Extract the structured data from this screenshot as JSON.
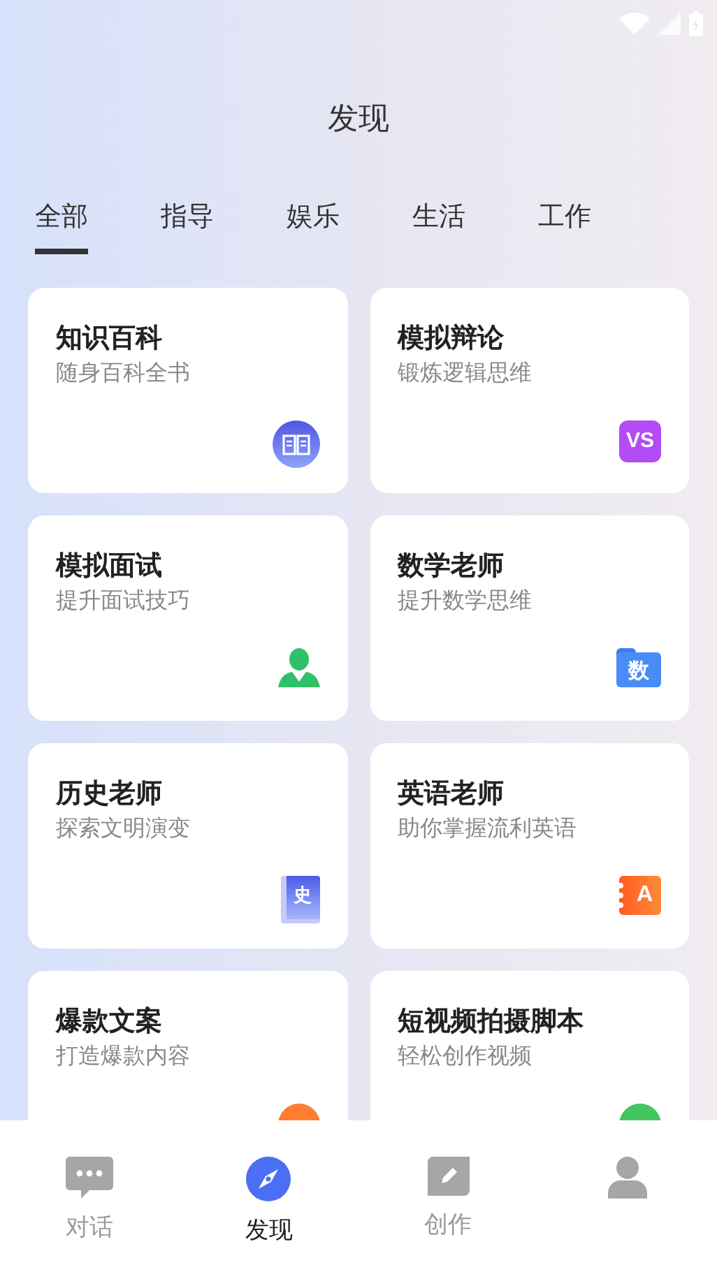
{
  "header": {
    "title": "发现"
  },
  "tabs": [
    {
      "label": "全部",
      "selected": true
    },
    {
      "label": "指导",
      "selected": false
    },
    {
      "label": "娱乐",
      "selected": false
    },
    {
      "label": "生活",
      "selected": false
    },
    {
      "label": "工作",
      "selected": false
    }
  ],
  "cards": [
    {
      "title": "知识百科",
      "subtitle": "随身百科全书",
      "kind": "book"
    },
    {
      "title": "模拟辩论",
      "subtitle": "锻炼逻辑思维",
      "kind": "vs",
      "badge": "VS"
    },
    {
      "title": "模拟面试",
      "subtitle": "提升面试技巧",
      "kind": "person"
    },
    {
      "title": "数学老师",
      "subtitle": "提升数学思维",
      "kind": "folder",
      "badge": "数"
    },
    {
      "title": "历史老师",
      "subtitle": "探索文明演变",
      "kind": "history",
      "badge": "史"
    },
    {
      "title": "英语老师",
      "subtitle": "助你掌握流利英语",
      "kind": "notebook",
      "badge": "A"
    },
    {
      "title": "爆款文案",
      "subtitle": "打造爆款内容",
      "kind": "orange"
    },
    {
      "title": "短视频拍摄脚本",
      "subtitle": "轻松创作视频",
      "kind": "green"
    }
  ],
  "bottom_nav": [
    {
      "label": "对话",
      "kind": "chat",
      "selected": false
    },
    {
      "label": "发现",
      "kind": "compass",
      "selected": true
    },
    {
      "label": "创作",
      "kind": "pen",
      "selected": false
    },
    {
      "kind": "person",
      "selected": false
    }
  ]
}
